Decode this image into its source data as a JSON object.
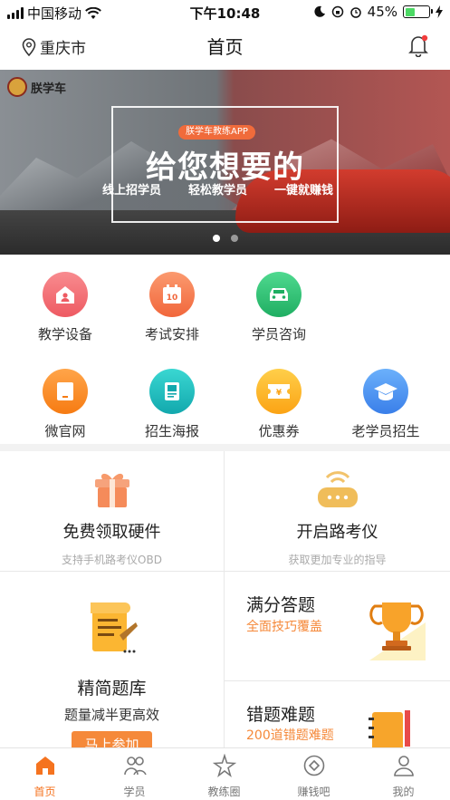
{
  "status": {
    "carrier": "中国移动",
    "time": "下午10:48",
    "battery": "45%",
    "battery_level": 0.45
  },
  "nav": {
    "city": "重庆市",
    "title": "首页"
  },
  "banner": {
    "brand": "朕学车",
    "pill": "朕学车教练APP",
    "headline": "给您想要的",
    "subs": [
      "线上招学员",
      "轻松教学员",
      "一键就赚钱"
    ]
  },
  "grid": {
    "items": [
      {
        "label": "教学设备",
        "icon": "home-user-icon",
        "color": "#f36d73"
      },
      {
        "label": "考试安排",
        "icon": "calendar-icon",
        "color": "#f57b4f"
      },
      {
        "label": "学员咨询",
        "icon": "car-icon",
        "color": "#32c37c"
      },
      {
        "label": "微官网",
        "icon": "tablet-icon",
        "color": "#fa8e2a"
      },
      {
        "label": "招生海报",
        "icon": "poster-icon",
        "color": "#20c1c1"
      },
      {
        "label": "优惠券",
        "icon": "coupon-icon",
        "color": "#fcb52b"
      },
      {
        "label": "老学员招生",
        "icon": "graduation-cap-icon",
        "color": "#4f97f3"
      }
    ]
  },
  "promos": {
    "free": {
      "title": "免费领取硬件",
      "sub": "支持手机路考仪OBD"
    },
    "route": {
      "title": "开启路考仪",
      "sub": "获取更加专业的指导"
    },
    "bank": {
      "title": "精简题库",
      "sub": "题量减半更高效",
      "button": "马上参加"
    },
    "full": {
      "title": "满分答题",
      "sub": "全面技巧覆盖"
    },
    "wrong": {
      "title": "错题难题",
      "sub": "200道错题难题"
    }
  },
  "tabs": [
    {
      "label": "首页",
      "icon": "home-icon",
      "active": true
    },
    {
      "label": "学员",
      "icon": "students-icon",
      "active": false
    },
    {
      "label": "教练圈",
      "icon": "sparkle-icon",
      "active": false
    },
    {
      "label": "赚钱吧",
      "icon": "diamond-icon",
      "active": false
    },
    {
      "label": "我的",
      "icon": "profile-icon",
      "active": false
    }
  ],
  "colors": {
    "accent": "#f5731f",
    "promo_sub": "#f5893a"
  }
}
